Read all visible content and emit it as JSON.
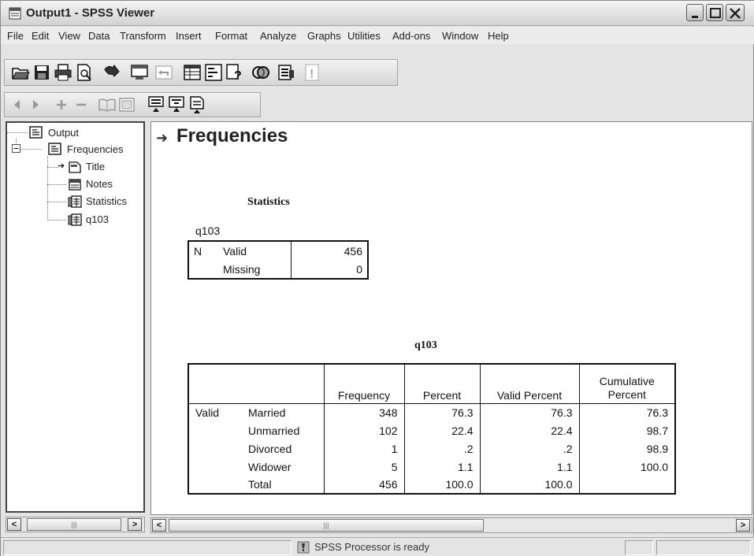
{
  "window": {
    "title": "Output1 - SPSS Viewer"
  },
  "menu": [
    "File",
    "Edit",
    "View",
    "Data",
    "Transform",
    "Insert",
    "Format",
    "Analyze",
    "Graphs",
    "Utilities",
    "Add-ons",
    "Window",
    "Help"
  ],
  "toolbar1": [
    "open-icon",
    "save-icon",
    "print-icon",
    "print-preview-icon",
    "export-icon",
    "recall-dialog-icon",
    "undo-icon",
    "goto-data-icon",
    "variables-icon",
    "help-icon",
    "use-sets-icon",
    "designate-window-icon",
    "run-icon"
  ],
  "toolbar2": [
    "promote-icon",
    "demote-icon",
    "expand-icon",
    "collapse-icon",
    "show-icon",
    "hide-icon",
    "insert-heading-icon",
    "insert-title-icon",
    "insert-text-icon"
  ],
  "outline": {
    "root": "Output",
    "group": "Frequencies",
    "items": [
      "Title",
      "Notes",
      "Statistics",
      "q103"
    ]
  },
  "content": {
    "heading": "Frequencies",
    "statistics": {
      "title": "Statistics",
      "variable": "q103",
      "n_label": "N",
      "rows": [
        {
          "label": "Valid",
          "value": "456"
        },
        {
          "label": "Missing",
          "value": "0"
        }
      ]
    },
    "frequency_table": {
      "title": "q103",
      "headers": [
        "Frequency",
        "Percent",
        "Valid Percent",
        "Cumulative Percent"
      ],
      "group_label": "Valid",
      "rows": [
        {
          "label": "Married",
          "frequency": "348",
          "percent": "76.3",
          "valid_percent": "76.3",
          "cumulative": "76.3"
        },
        {
          "label": "Unmarried",
          "frequency": "102",
          "percent": "22.4",
          "valid_percent": "22.4",
          "cumulative": "98.7"
        },
        {
          "label": "Divorced",
          "frequency": "1",
          "percent": ".2",
          "valid_percent": ".2",
          "cumulative": "98.9"
        },
        {
          "label": "Widower",
          "frequency": "5",
          "percent": "1.1",
          "valid_percent": "1.1",
          "cumulative": "100.0"
        },
        {
          "label": "Total",
          "frequency": "456",
          "percent": "100.0",
          "valid_percent": "100.0",
          "cumulative": ""
        }
      ]
    }
  },
  "status": {
    "text": "SPSS Processor  is ready"
  }
}
